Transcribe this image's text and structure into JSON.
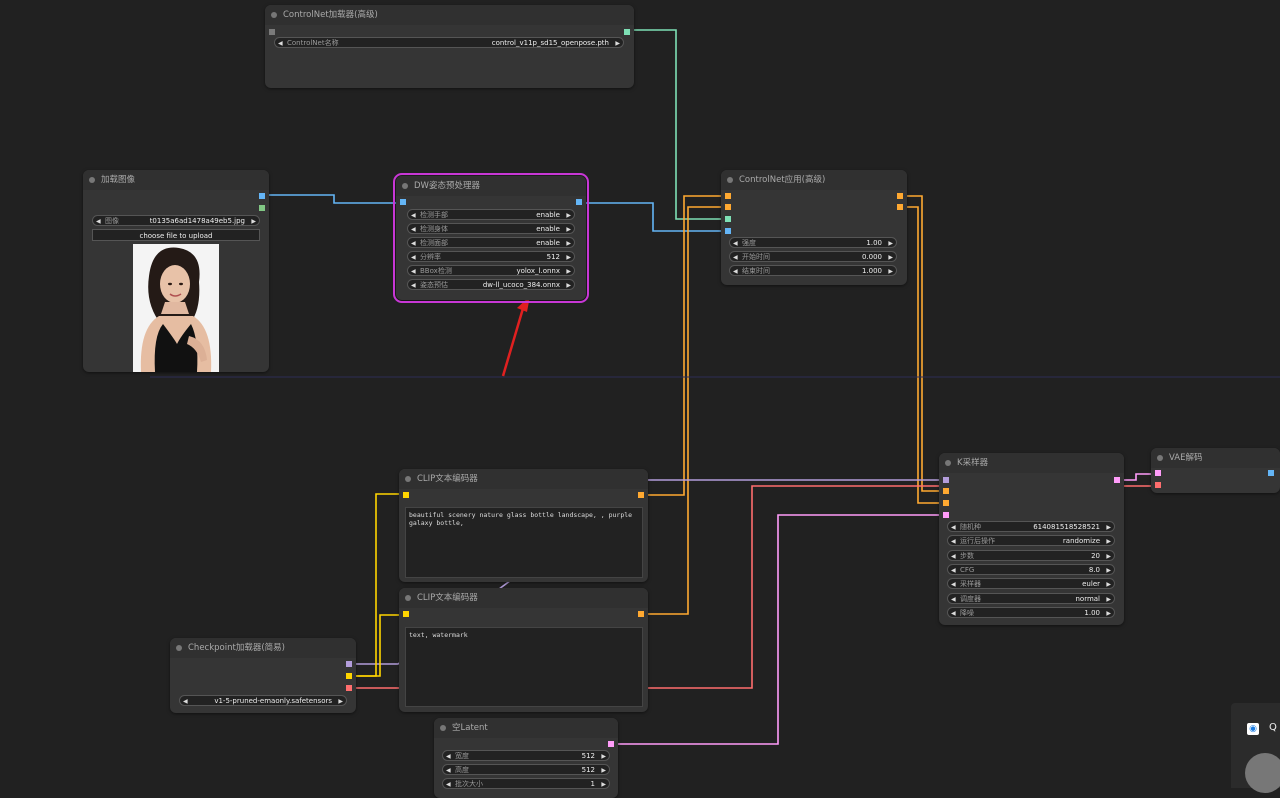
{
  "nodes": {
    "controlnet_loader": {
      "title": "ControlNet加载器(高级)",
      "widget": {
        "label": "ControlNet名称",
        "value": "control_v11p_sd15_openpose.pth"
      }
    },
    "load_image": {
      "title": "加载图像",
      "widget": {
        "label": "图像",
        "value": "t0135a6ad1478a49eb5.jpg"
      },
      "upload_label": "choose file to upload"
    },
    "dw_preprocessor": {
      "title": "DW姿态预处理器",
      "widgets": [
        {
          "label": "检测手部",
          "value": "enable"
        },
        {
          "label": "检测身体",
          "value": "enable"
        },
        {
          "label": "检测面部",
          "value": "enable"
        },
        {
          "label": "分辨率",
          "value": "512"
        },
        {
          "label": "BBox检测",
          "value": "yolox_l.onnx"
        },
        {
          "label": "姿态预估",
          "value": "dw-ll_ucoco_384.onnx"
        }
      ]
    },
    "controlnet_apply": {
      "title": "ControlNet应用(高级)",
      "widgets": [
        {
          "label": "强度",
          "value": "1.00"
        },
        {
          "label": "开始时间",
          "value": "0.000"
        },
        {
          "label": "结束时间",
          "value": "1.000"
        }
      ]
    },
    "clip_pos": {
      "title": "CLIP文本编码器",
      "text": "beautiful scenery nature glass bottle landscape, , purple galaxy bottle,"
    },
    "clip_neg": {
      "title": "CLIP文本编码器",
      "text": "text, watermark"
    },
    "checkpoint": {
      "title": "Checkpoint加载器(简易)",
      "widget": {
        "label": "",
        "value": "v1-5-pruned-emaonly.safetensors",
        "overlap": "Ckpt名称"
      }
    },
    "empty_latent": {
      "title": "空Latent",
      "widgets": [
        {
          "label": "宽度",
          "value": "512"
        },
        {
          "label": "高度",
          "value": "512"
        },
        {
          "label": "批次大小",
          "value": "1"
        }
      ]
    },
    "ksampler": {
      "title": "K采样器",
      "widgets": [
        {
          "label": "随机种",
          "value": "614081518528521"
        },
        {
          "label": "运行后操作",
          "value": "randomize"
        },
        {
          "label": "步数",
          "value": "20"
        },
        {
          "label": "CFG",
          "value": "8.0"
        },
        {
          "label": "采样器",
          "value": "euler"
        },
        {
          "label": "调度器",
          "value": "normal"
        },
        {
          "label": "降噪",
          "value": "1.00"
        }
      ]
    },
    "vae_decode": {
      "title": "VAE解码"
    }
  },
  "side_panel": {
    "label": "Q",
    "icon": "qq-icon"
  },
  "colors": {
    "controlnet_wire": "#7ee0b5",
    "image_wire": "#64b5f6",
    "conditioning_wire": "#ffa931",
    "clip_wire": "#ffd500",
    "model_wire": "#b39ddb",
    "vae_wire": "#ff6e6e",
    "latent_wire": "#ff9cf9",
    "selected_outline": "#c837d6",
    "annotation_arrow": "#e02020"
  }
}
